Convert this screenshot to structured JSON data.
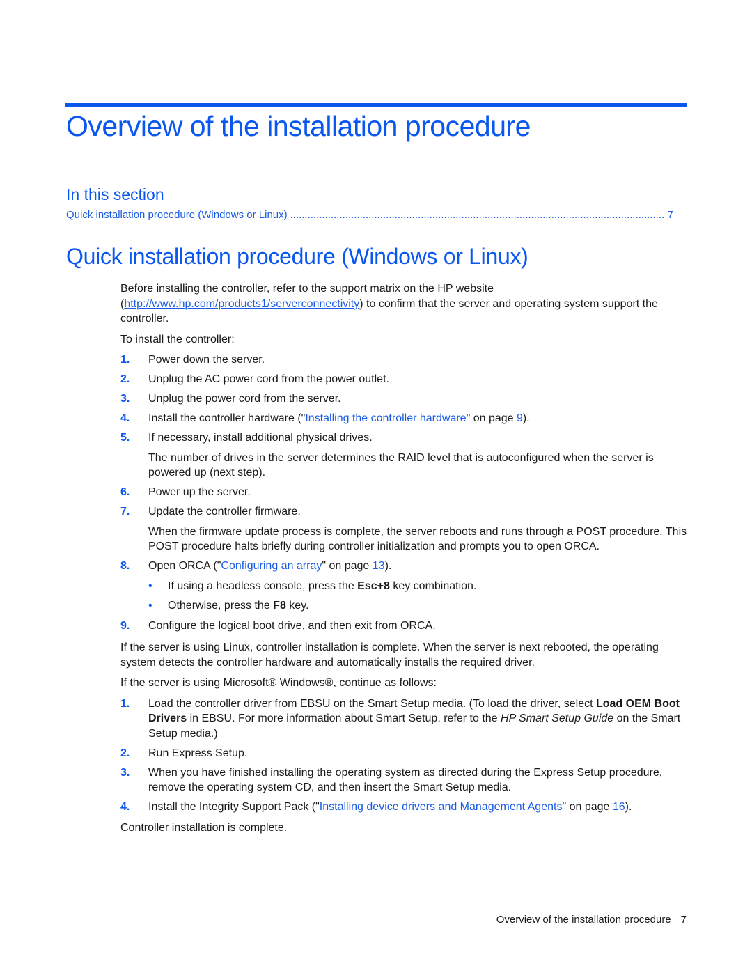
{
  "colors": {
    "accent": "#0a57f0",
    "link": "#1a5ce6",
    "text": "#1a1a1a"
  },
  "title": "Overview of the installation procedure",
  "in_this_section": {
    "heading": "In this section",
    "entries": [
      {
        "label": "Quick installation procedure (Windows or Linux)",
        "page": "7"
      }
    ]
  },
  "section": {
    "heading": "Quick installation procedure (Windows or Linux)",
    "intro": {
      "before": "Before installing the controller, refer to the support matrix on the HP website (",
      "url": "http://www.hp.com/products1/serverconnectivity",
      "after": ") to confirm that the server and operating system support the controller."
    },
    "to_install": "To install the controller:",
    "steps": [
      {
        "num": "1.",
        "text": "Power down the server."
      },
      {
        "num": "2.",
        "text": "Unplug the AC power cord from the power outlet."
      },
      {
        "num": "3.",
        "text": "Unplug the power cord from the server."
      },
      {
        "num": "4.",
        "pre": "Install the controller hardware (\"",
        "link": "Installing the controller hardware",
        "mid": "\" on page ",
        "page": "9",
        "post": ")."
      },
      {
        "num": "5.",
        "text": "If necessary, install additional physical drives.",
        "sub": "The number of drives in the server determines the RAID level that is autoconfigured when the server is powered up (next step)."
      },
      {
        "num": "6.",
        "text": "Power up the server."
      },
      {
        "num": "7.",
        "text": "Update the controller firmware.",
        "sub": "When the firmware update process is complete, the server reboots and runs through a POST procedure. This POST procedure halts briefly during controller initialization and prompts you to open ORCA."
      },
      {
        "num": "8.",
        "pre": "Open ORCA (\"",
        "link": "Configuring an array",
        "mid": "\" on page ",
        "page": "13",
        "post": ").",
        "bullets": [
          {
            "pre": "If using a headless console, press the ",
            "bold": "Esc+8",
            "post": " key combination."
          },
          {
            "pre": "Otherwise, press the ",
            "bold": "F8",
            "post": " key."
          }
        ]
      },
      {
        "num": "9.",
        "text": "Configure the logical boot drive, and then exit from ORCA."
      }
    ],
    "linux_note": "If the server is using Linux, controller installation is complete. When the server is next rebooted, the operating system detects the controller hardware and automatically installs the required driver.",
    "windows_intro": "If the server is using Microsoft® Windows®, continue as follows:",
    "win_steps": [
      {
        "num": "1.",
        "t1": "Load the controller driver from EBSU on the Smart Setup media. (To load the driver, select ",
        "b1": "Load OEM Boot Drivers",
        "t2": " in EBSU. For more information about Smart Setup, refer to the ",
        "i1": "HP Smart Setup Guide",
        "t3": " on the Smart Setup media.)"
      },
      {
        "num": "2.",
        "text": "Run Express Setup."
      },
      {
        "num": "3.",
        "text": "When you have finished installing the operating system as directed during the Express Setup procedure, remove the operating system CD, and then insert the Smart Setup media."
      },
      {
        "num": "4.",
        "pre": "Install the Integrity Support Pack (\"",
        "link": "Installing device drivers and Management Agents",
        "mid": "\" on page ",
        "page": "16",
        "post": ")."
      }
    ],
    "closing": "Controller installation is complete."
  },
  "footer": {
    "label": "Overview of the installation procedure",
    "page": "7"
  }
}
